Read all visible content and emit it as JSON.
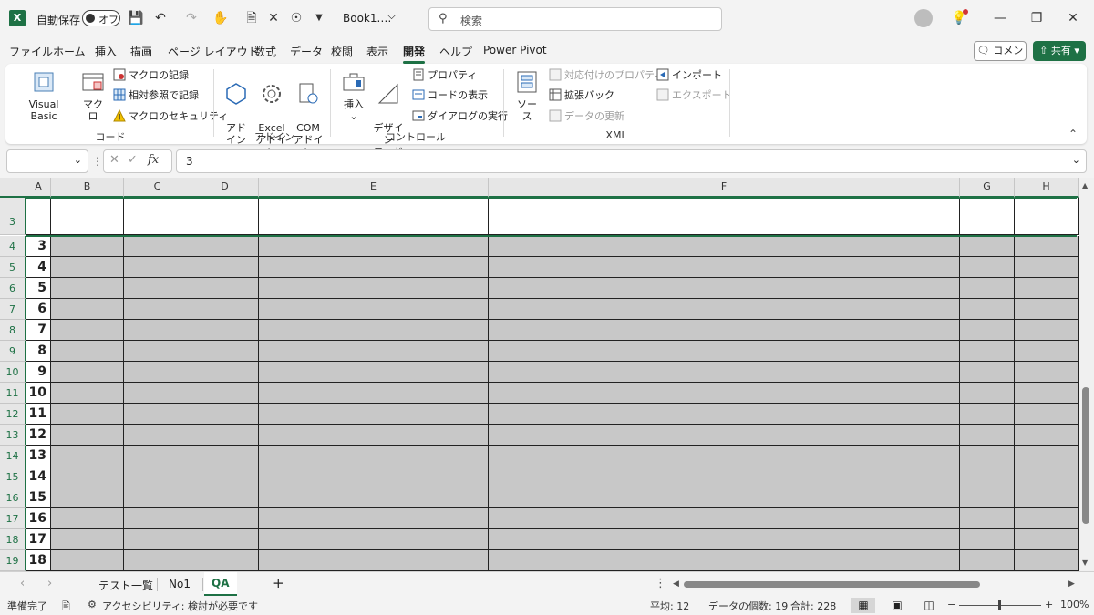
{
  "titlebar": {
    "logo": "X",
    "autosave_label": "自動保存",
    "autosave_state": "オフ",
    "filename": "Book1.…",
    "filename_chevron": "⌵",
    "search_placeholder": "検索",
    "min": "—",
    "restore": "❐",
    "close": "✕"
  },
  "tabs": [
    "ファイル",
    "ホーム",
    "挿入",
    "描画",
    "ページ レイアウト",
    "数式",
    "データ",
    "校閲",
    "表示",
    "開発",
    "ヘルプ",
    "Power Pivot"
  ],
  "active_tab": "開発",
  "comment_label": "コメント",
  "share_label": "共有",
  "ribbon": {
    "code": {
      "group_label": "コード",
      "visual_basic": "Visual Basic",
      "macro": "マクロ",
      "record": "マクロの記録",
      "relative": "相対参照で記録",
      "security": "マクロのセキュリティ"
    },
    "addin": {
      "group_label": "アドイン",
      "addin": "アド\nイン",
      "excel_addin": "Excel\nアドイン",
      "com_addin": "COM\nアドイン"
    },
    "control": {
      "group_label": "コントロール",
      "insert": "挿入",
      "insert_chev": "⌄",
      "design_mode": "デザイン\nモード",
      "properties": "プロパティ",
      "view_code": "コードの表示",
      "run_dialog": "ダイアログの実行"
    },
    "xml": {
      "group_label": "XML",
      "source": "ソース",
      "map_props": "対応付けのプロパティ",
      "expansion": "拡張パック",
      "refresh": "データの更新",
      "import": "インポート",
      "export": "エクスポート"
    }
  },
  "formula_bar": {
    "name_box": "",
    "value": "3",
    "fx": "fx"
  },
  "columns": [
    "A",
    "B",
    "C",
    "D",
    "E",
    "F",
    "G",
    "H"
  ],
  "header_row_number": "3",
  "rows": [
    {
      "row": "4",
      "value": "3"
    },
    {
      "row": "5",
      "value": "4"
    },
    {
      "row": "6",
      "value": "5"
    },
    {
      "row": "7",
      "value": "6"
    },
    {
      "row": "8",
      "value": "7"
    },
    {
      "row": "9",
      "value": "8"
    },
    {
      "row": "10",
      "value": "9"
    },
    {
      "row": "11",
      "value": "10"
    },
    {
      "row": "12",
      "value": "11"
    },
    {
      "row": "13",
      "value": "12"
    },
    {
      "row": "14",
      "value": "13"
    },
    {
      "row": "15",
      "value": "14"
    },
    {
      "row": "16",
      "value": "15"
    },
    {
      "row": "17",
      "value": "16"
    },
    {
      "row": "18",
      "value": "17"
    },
    {
      "row": "19",
      "value": "18"
    }
  ],
  "sheets": [
    "テスト一覧",
    "No1",
    "QA"
  ],
  "active_sheet": "QA",
  "add_sheet": "+",
  "status": {
    "ready": "準備完了",
    "accessibility": "アクセシビリティ: 検討が必要です",
    "average": "平均: 12",
    "count": "データの個数: 19",
    "sum": "合計: 228",
    "zoom_minus": "−",
    "zoom_plus": "+",
    "zoom": "100%"
  },
  "colors": {
    "accent": "#1e7145",
    "cell_fill": "#c8c8c8"
  }
}
